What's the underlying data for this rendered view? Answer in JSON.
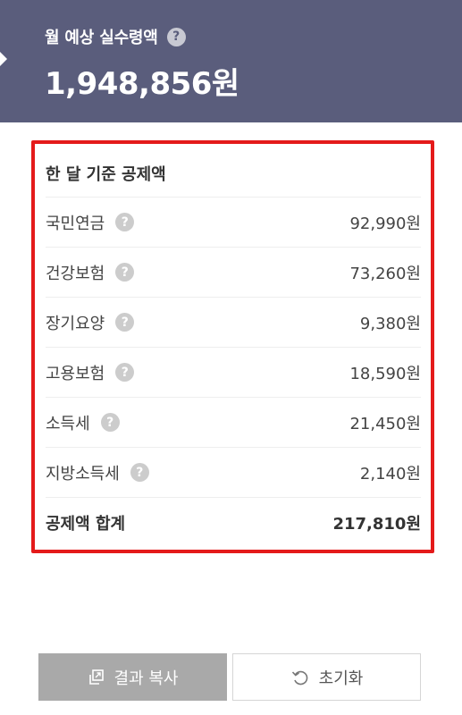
{
  "header": {
    "label": "월 예상 실수령액",
    "help_glyph": "?",
    "amount": "1,948,856원",
    "background_color": "#5a5d7c"
  },
  "deductions": {
    "title": "한 달 기준 공제액",
    "items": [
      {
        "label": "국민연금",
        "value": "92,990원",
        "icon": "help-icon"
      },
      {
        "label": "건강보험",
        "value": "73,260원",
        "icon": "help-icon"
      },
      {
        "label": "장기요양",
        "value": "9,380원",
        "icon": "help-icon"
      },
      {
        "label": "고용보험",
        "value": "18,590원",
        "icon": "help-icon"
      },
      {
        "label": "소득세",
        "value": "21,450원",
        "icon": "help-icon"
      },
      {
        "label": "지방소득세",
        "value": "2,140원",
        "icon": "help-icon"
      }
    ],
    "total": {
      "label": "공제액 합계",
      "value": "217,810원"
    },
    "highlight_color": "#e41a1a"
  },
  "actions": {
    "copy": {
      "label": "결과 복사",
      "icon": "copy-icon"
    },
    "reset": {
      "label": "초기화",
      "icon": "refresh-icon"
    }
  }
}
